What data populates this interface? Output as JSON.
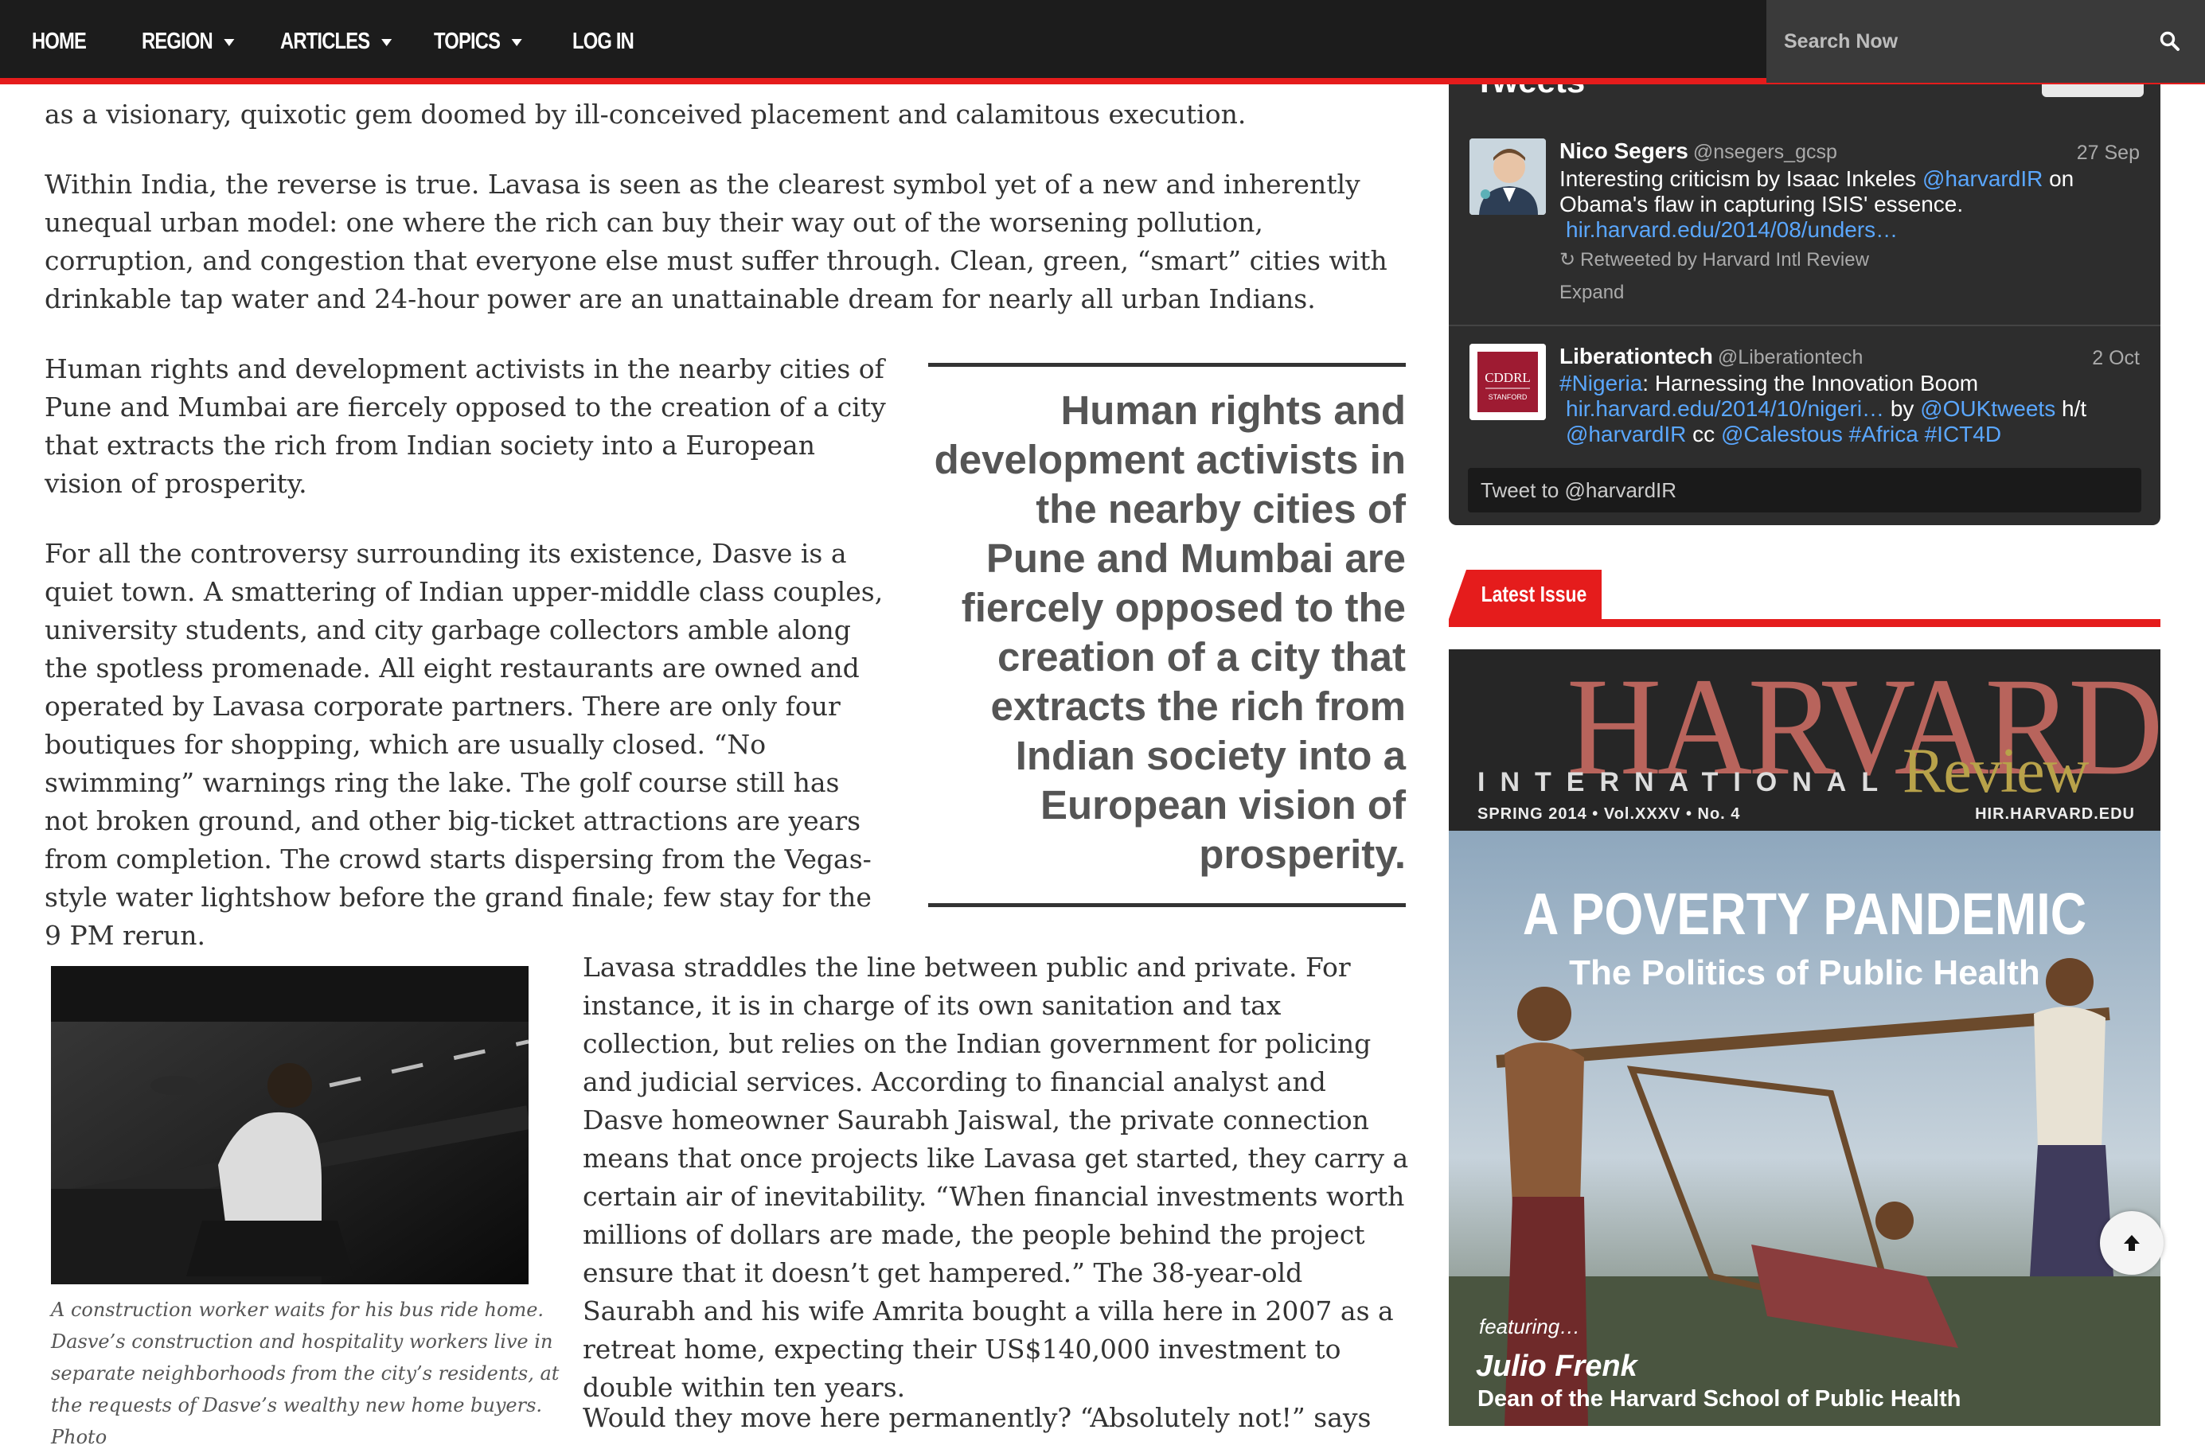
{
  "nav": {
    "items": [
      {
        "label": "HOME"
      },
      {
        "label": "REGION"
      },
      {
        "label": "ARTICLES"
      },
      {
        "label": "TOPICS"
      },
      {
        "label": "LOG IN"
      }
    ],
    "search_placeholder": "Search Now",
    "accent_color": "#e51c1c"
  },
  "article": {
    "p1": "as a visionary, quixotic gem doomed by ill-conceived placement and calamitous execution.",
    "p2": "Within India, the reverse is true. Lavasa is seen as the clearest symbol yet of a new and inherently unequal urban model: one where the rich can buy their way out of the worsening pollution, corruption, and congestion that everyone else must suffer through. Clean, green, “smart” cities with drinkable tap water and 24-hour power are an unattainable dream for nearly all urban Indians.",
    "p3": "Human rights and development activists in the nearby cities of Pune and Mumbai are fiercely opposed to the creation of a city that extracts the rich from Indian society into a European vision of prosperity.",
    "p4": "For all the controversy surrounding its existence, Dasve is a quiet town. A smattering of Indian upper-middle class couples, university students, and city garbage collectors amble along the spotless promenade. All eight restaurants are owned and operated by Lavasa corporate partners. There are only four boutiques for shopping, which are usually closed. “No swimming” warnings ring the lake. The golf course still has not broken ground, and other big-ticket attractions are years from completion. The crowd starts dispersing from the Vegas-style water lightshow before the grand finale; few stay for the 9 PM rerun.",
    "pullquote": "Human rights and development activists in the nearby cities of Pune and Mumbai are fiercely opposed to the creation of a city that extracts the rich from Indian society into a European vision of prosperity.",
    "p5": "Lavasa straddles the line between public and private. For instance, it is in charge of its own sanitation and tax collection, but relies on the Indian government for policing and judicial services. According to financial analyst and Dasve homeowner Saurabh Jaiswal, the private connection means that once projects like Lavasa get started, they carry a certain air of inevitability. “When financial investments worth millions of dollars are made, the people behind the project ensure that it doesn’t get hampered.” The 38-year-old Saurabh and his wife Amrita bought a villa here in 2007 as a retreat home, expecting their US$140,000 investment to double within ten years.",
    "p6": "Would they move here permanently? “Absolutely not!” says",
    "caption": "A construction worker waits for his bus ride home. Dasve’s construction and hospitality workers live in separate neighborhoods from the city’s residents, at the requests of Dasve’s wealthy new home buyers. Photo"
  },
  "tweets": {
    "header_title": "Tweets",
    "items": [
      {
        "name": "Nico Segers",
        "handle": "@nsegers_gcsp",
        "date": "27 Sep",
        "text_a": "Interesting criticism by Isaac Inkeles ",
        "mention": "@harvardIR",
        "text_b": " on Obama's flaw in capturing ISIS' essence.",
        "link": "hir.harvard.edu/2014/08/unders…",
        "retweet": "Retweeted by Harvard Intl Review",
        "expand": "Expand"
      },
      {
        "name": "Liberationtech",
        "handle": "@Liberationtech",
        "date": "2 Oct",
        "hashtag": "#Nigeria",
        "text_a": ": Harnessing the Innovation Boom",
        "link": "hir.harvard.edu/2014/10/nigeri…",
        "by": " by ",
        "mention1": "@OUKtweets",
        "ht": " h/t",
        "mention2": "@harvardIR",
        "cc": " cc ",
        "mention3": "@Calestous",
        "tag2": "#Africa",
        "tag3": "#ICT4D",
        "avatar_text_1": "CDDRL",
        "avatar_text_2": "STANFORD"
      }
    ],
    "tweet_to": "Tweet to @harvardIR"
  },
  "latest_issue": {
    "label": "Latest Issue",
    "cover": {
      "masthead": "HARVARD",
      "international": "INTERNATIONAL",
      "review": "Review",
      "issue": "SPRING 2014 • Vol.XXXV • No. 4",
      "url": "HIR.HARVARD.EDU",
      "headline": "A POVERTY PANDEMIC",
      "subhead": "The Politics of Public Health",
      "featuring": "featuring…",
      "person": "Julio Frenk",
      "role": "Dean of the Harvard School of Public Health"
    }
  }
}
